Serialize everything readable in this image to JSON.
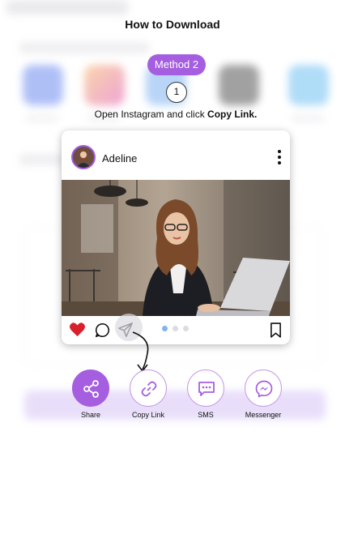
{
  "dialog": {
    "title": "How to Download",
    "method_label": "Method 2",
    "step_number": "1",
    "instruction_prefix": "Open Instagram and click ",
    "instruction_bold": "Copy Link.",
    "accent_color": "#a55ee0"
  },
  "post": {
    "username": "Adeline",
    "liked": true,
    "carousel_dots": 3,
    "active_dot": 0
  },
  "share_options": [
    {
      "label": "Share",
      "icon": "share-icon",
      "active": true
    },
    {
      "label": "Copy Link",
      "icon": "link-icon",
      "active": false
    },
    {
      "label": "SMS",
      "icon": "sms-icon",
      "active": false
    },
    {
      "label": "Messenger",
      "icon": "messenger-icon",
      "active": false
    }
  ]
}
